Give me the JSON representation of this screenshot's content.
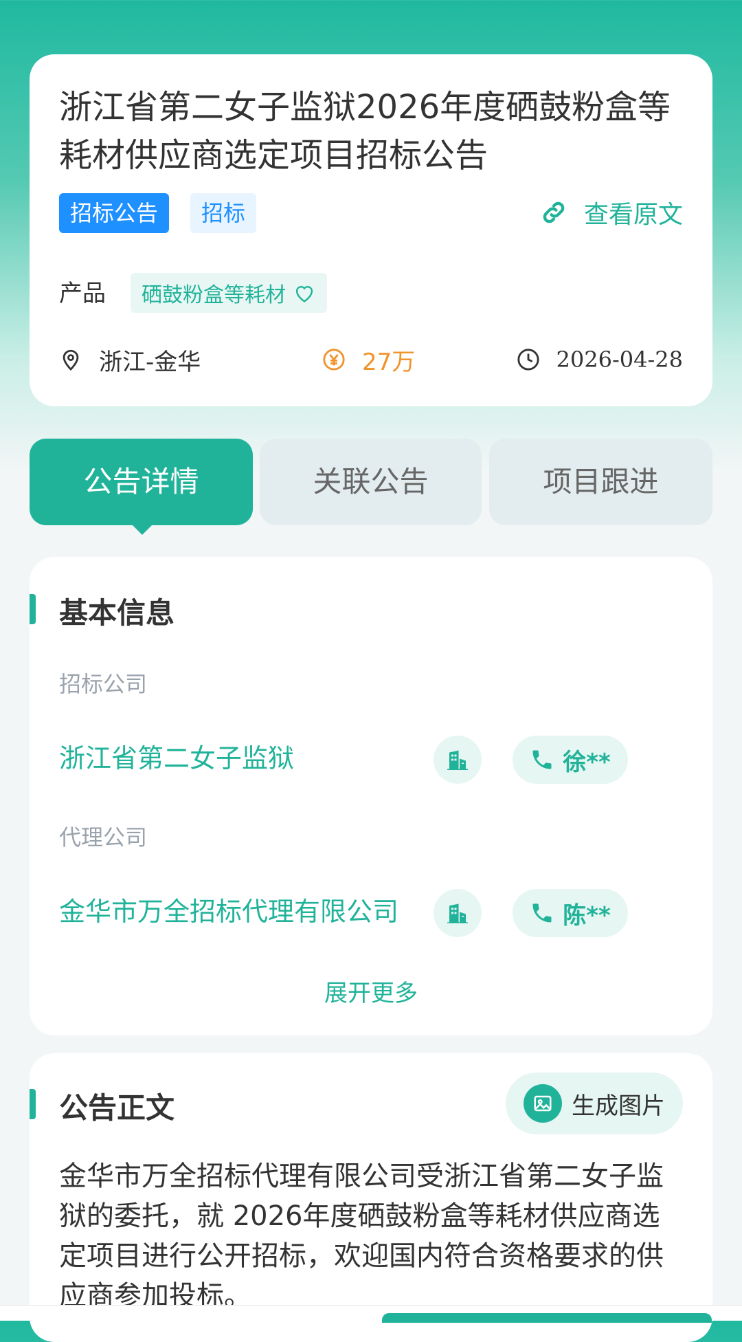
{
  "header": {
    "title": "浙江省第二女子监狱2026年度硒鼓粉盒等耗材供应商选定项目招标公告",
    "tags": [
      "招标公告",
      "招标"
    ],
    "view_original": "查看原文",
    "product_label": "产品",
    "product_value": "硒鼓粉盒等耗材",
    "location": "浙江-金华",
    "amount": "27万",
    "date": "2026-04-28"
  },
  "tabs": [
    {
      "label": "公告详情",
      "active": true
    },
    {
      "label": "关联公告",
      "active": false
    },
    {
      "label": "项目跟进",
      "active": false
    }
  ],
  "basic_info": {
    "section_title": "基本信息",
    "tender_label": "招标公司",
    "tender_company": "浙江省第二女子监狱",
    "tender_contact": "徐**",
    "agent_label": "代理公司",
    "agent_company": "金华市万全招标代理有限公司",
    "agent_contact": "陈**",
    "expand_more": "展开更多"
  },
  "notice_body": {
    "section_title": "公告正文",
    "generate_image": "生成图片",
    "text": "金华市万全招标代理有限公司受浙江省第二女子监狱的委托，就 2026年度硒鼓粉盒等耗材供应商选定项目进行公开招标，欢迎国内符合资格要求的供应商参加投标。"
  },
  "colors": {
    "accent": "#21b39a",
    "tag_blue": "#1e90ff",
    "amount_orange": "#f0932b"
  },
  "icons": [
    "link-icon",
    "heart-icon",
    "location-icon",
    "yuan-icon",
    "clock-icon",
    "building-icon",
    "phone-icon",
    "image-icon"
  ]
}
